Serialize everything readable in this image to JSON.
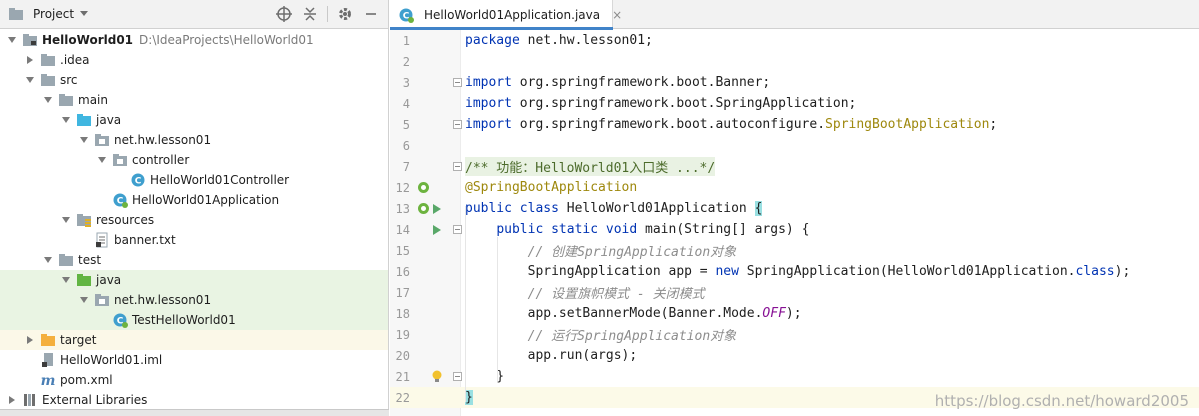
{
  "panel": {
    "title": "Project",
    "tools": [
      "target-icon",
      "collapse-icon",
      "gear-icon",
      "minimize-icon"
    ]
  },
  "tree": [
    {
      "label": "HelloWorld01",
      "path": "D:\\IdeaProjects\\HelloWorld01",
      "indent": 0,
      "arrow": "down",
      "icon": "module-folder-icon",
      "bold": true
    },
    {
      "label": ".idea",
      "indent": 1,
      "arrow": "right",
      "icon": "folder-icon"
    },
    {
      "label": "src",
      "indent": 1,
      "arrow": "down",
      "icon": "folder-icon"
    },
    {
      "label": "main",
      "indent": 2,
      "arrow": "down",
      "icon": "folder-icon"
    },
    {
      "label": "java",
      "indent": 3,
      "arrow": "down",
      "icon": "source-folder-icon"
    },
    {
      "label": "net.hw.lesson01",
      "indent": 4,
      "arrow": "down",
      "icon": "package-icon"
    },
    {
      "label": "controller",
      "indent": 5,
      "arrow": "down",
      "icon": "package-icon"
    },
    {
      "label": "HelloWorld01Controller",
      "indent": 6,
      "arrow": "none",
      "icon": "class-icon"
    },
    {
      "label": "HelloWorld01Application",
      "indent": 5,
      "arrow": "none",
      "icon": "spring-class-icon"
    },
    {
      "label": "resources",
      "indent": 3,
      "arrow": "down",
      "icon": "resources-folder-icon"
    },
    {
      "label": "banner.txt",
      "indent": 4,
      "arrow": "none",
      "icon": "text-file-icon"
    },
    {
      "label": "test",
      "indent": 2,
      "arrow": "down",
      "icon": "folder-icon"
    },
    {
      "label": "java",
      "indent": 3,
      "arrow": "down",
      "icon": "test-folder-icon",
      "bg": "test"
    },
    {
      "label": "net.hw.lesson01",
      "indent": 4,
      "arrow": "down",
      "icon": "package-icon",
      "bg": "test"
    },
    {
      "label": "TestHelloWorld01",
      "indent": 5,
      "arrow": "none",
      "icon": "spring-class-icon",
      "bg": "test"
    },
    {
      "label": "target",
      "indent": 1,
      "arrow": "right",
      "icon": "excluded-folder-icon",
      "bg": "target"
    },
    {
      "label": "HelloWorld01.iml",
      "indent": 1,
      "arrow": "none",
      "icon": "iml-file-icon"
    },
    {
      "label": "pom.xml",
      "indent": 1,
      "arrow": "none",
      "icon": "maven-icon"
    },
    {
      "label": "External Libraries",
      "indent": 0,
      "arrow": "right",
      "icon": "libraries-icon"
    }
  ],
  "editor": {
    "tab_label": "HelloWorld01Application.java",
    "close_glyph": "×",
    "watermark": "https://blog.csdn.net/howard2005",
    "lines": [
      {
        "n": "1",
        "code": "<span class='kw'>package</span> net.hw.lesson01;"
      },
      {
        "n": "2",
        "code": ""
      },
      {
        "n": "3",
        "code": "<span class='kw'>import</span> org.springframework.boot.Banner;",
        "fold": true
      },
      {
        "n": "4",
        "code": "<span class='kw'>import</span> org.springframework.boot.SpringApplication;"
      },
      {
        "n": "5",
        "code": "<span class='kw'>import</span> org.springframework.boot.autoconfigure.<span class='ann'>SpringBootApplication</span>;",
        "fold": true
      },
      {
        "n": "6",
        "code": ""
      },
      {
        "n": "7",
        "code": "<span class='doc'>/** 功能：HelloWorld01入口类 ...*/</span>",
        "fold": true,
        "docbg": true
      },
      {
        "n": "12",
        "code": "<span class='ann'>@SpringBootApplication</span>",
        "mark": "bean"
      },
      {
        "n": "13",
        "code": "<span class='kw'>public class</span> HelloWorld01Application <span class='brace-hl'>{</span>",
        "mark": "bean",
        "run": true
      },
      {
        "n": "14",
        "code": "    <span class='kw'>public static void</span> main(String[] args) {",
        "run": true,
        "fold": true
      },
      {
        "n": "15",
        "code": "        <span class='cmt'>// 创建SpringApplication对象</span>"
      },
      {
        "n": "16",
        "code": "        SpringApplication app = <span class='kw'>new</span> SpringApplication(HelloWorld01Application.<span class='kw'>class</span>);"
      },
      {
        "n": "17",
        "code": "        <span class='cmt'>// 设置旗帜模式 - 关闭模式</span>"
      },
      {
        "n": "18",
        "code": "        app.setBannerMode(Banner.Mode.<span class='cst'>OFF</span>);"
      },
      {
        "n": "19",
        "code": "        <span class='cmt'>// 运行SpringApplication对象</span>"
      },
      {
        "n": "20",
        "code": "        app.run(args);"
      },
      {
        "n": "21",
        "code": "    }",
        "bulb": true,
        "fold": true
      },
      {
        "n": "22",
        "code": "<span class='brace-hl'>}</span>",
        "hl": true
      }
    ]
  },
  "colors": {
    "keyword": "#0033b3",
    "annotation": "#9e880d",
    "comment": "#8c8c8c",
    "selection_test": "#e9f4e3",
    "tab_accent": "#4083c9"
  }
}
